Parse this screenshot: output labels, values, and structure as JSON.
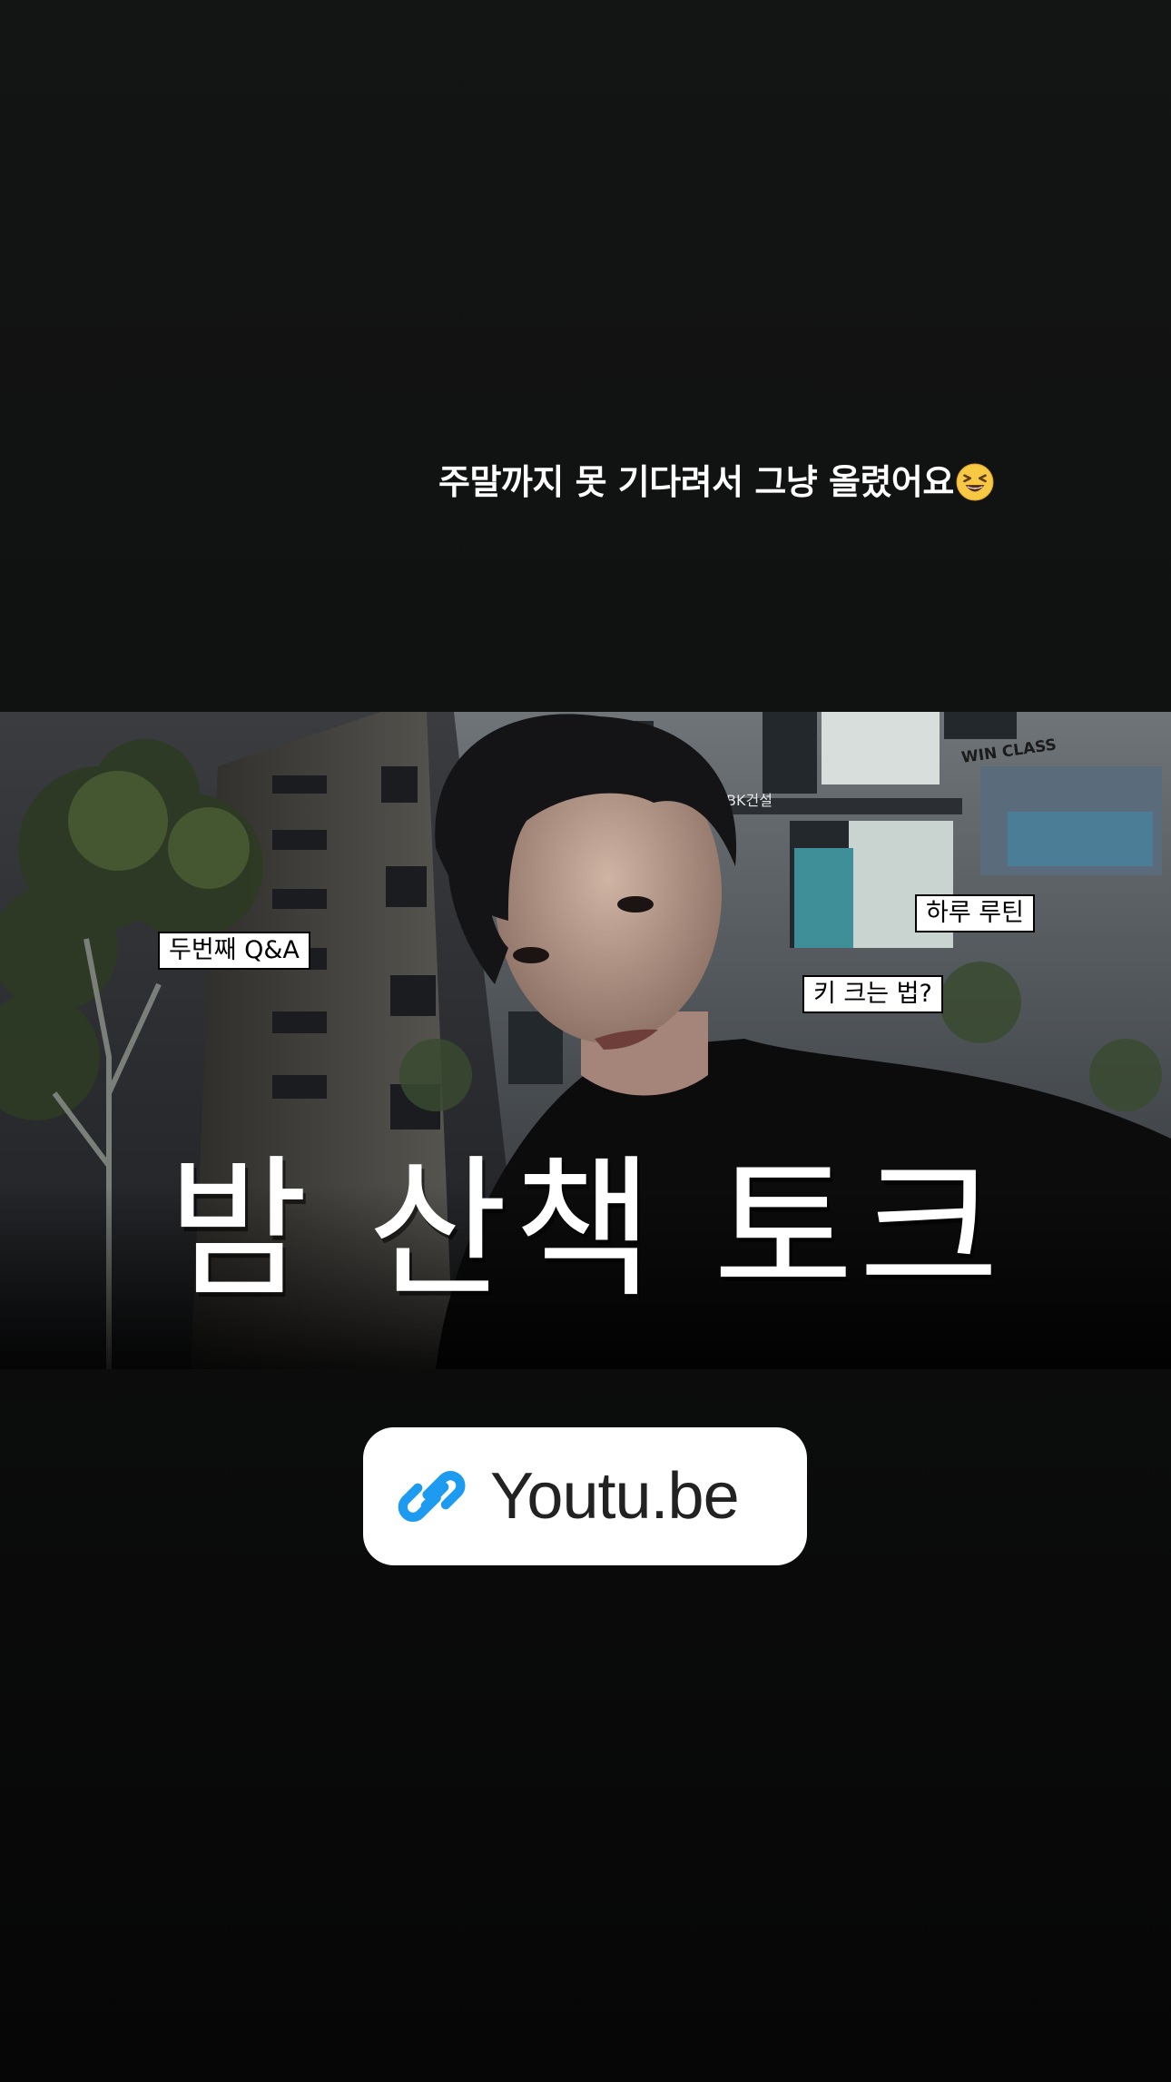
{
  "story": {
    "caption": "주말까지 못 기다려서 그냥 올렸어요",
    "caption_emoji": "grinning-squinting-face-emoji"
  },
  "thumbnail": {
    "tags": {
      "qa": "두번째 Q&A",
      "routine": "하루 루틴",
      "height": "키 크는 법?"
    },
    "title": "밤 산책 토크",
    "building_signs": {
      "sign_left": "BK건설",
      "sign_right": "WIN CLASS"
    }
  },
  "link_sticker": {
    "icon": "link-icon",
    "label": "Youtu.be",
    "accent_color": "#1d9bf0"
  }
}
